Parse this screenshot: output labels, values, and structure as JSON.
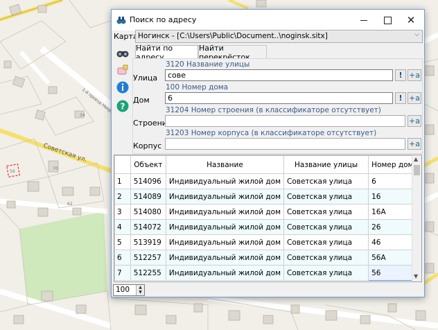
{
  "map": {
    "street_label": "Советская ул.",
    "side_street_label": "1-й проезд Некр...",
    "house_numbers": [
      "56",
      "62",
      "70",
      "34"
    ]
  },
  "window": {
    "title": "Поиск по адресу",
    "karta_label": "Карта",
    "karta_value": "Ногинск - [C:\\Users\\Public\\Document..\\noginsk.sitx]"
  },
  "tabs": [
    {
      "label": "Найти по адресу",
      "active": true
    },
    {
      "label": "Найти перекрёсток",
      "active": false
    }
  ],
  "form": {
    "street_hint": "3120 Название улицы",
    "street_label": "Улица",
    "street_value": "сове",
    "house_hint": "100 Номер дома",
    "house_label": "Дом",
    "house_value": "6",
    "building_hint": "31204  Номер строения (в классификаторе отсутствует)",
    "building_label": "Строение",
    "building_value": "",
    "korpus_hint": "31203  Номер корпуса (в классификаторе отсутствует)",
    "korpus_label": "Корпус",
    "korpus_value": "",
    "excl_label": "!",
    "plus_a_label": "+a"
  },
  "grid": {
    "columns": [
      "",
      "Объект",
      "Название",
      "Название улицы",
      "Номер дома"
    ],
    "rows": [
      [
        "1",
        "514096",
        "Индивидуальный жилой дом",
        "Советская улица",
        "6"
      ],
      [
        "2",
        "514089",
        "Индивидуальный жилой дом",
        "Советская улица",
        "16"
      ],
      [
        "3",
        "514080",
        "Индивидуальный жилой дом",
        "Советская улица",
        "16А"
      ],
      [
        "4",
        "514072",
        "Индивидуальный жилой дом",
        "Советская улица",
        "26"
      ],
      [
        "5",
        "513919",
        "Индивидуальный жилой дом",
        "Советская улица",
        "46"
      ],
      [
        "6",
        "512257",
        "Индивидуальный жилой дом",
        "Советская улица",
        "56А"
      ],
      [
        "7",
        "512255",
        "Индивидуальный жилой дом",
        "Советская улица",
        "56"
      ]
    ]
  },
  "limit_value": "100",
  "colors": {
    "accent_border": "#6f9dd8",
    "hint_text": "#3a5a8a",
    "row_alt": "#effbfd"
  }
}
